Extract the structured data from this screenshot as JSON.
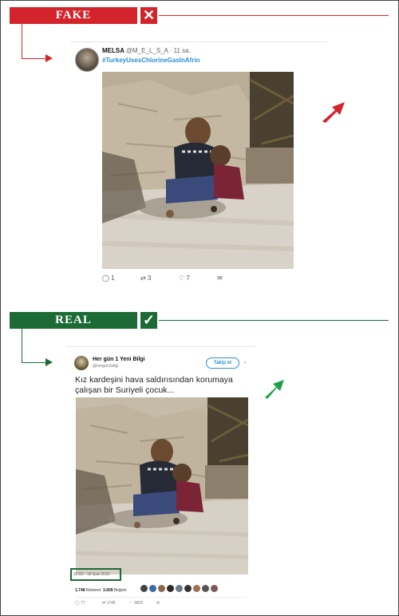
{
  "fake_section": {
    "label": "FAKE",
    "mark": "✕",
    "color": "#d3242b",
    "tweet": {
      "name": "MELSA",
      "handle": "@M_E_L_S_A · 11 sa.",
      "hashtag": "#TurkeyUsesChlorineGasInAfrin",
      "replies": "1",
      "retweets": "3",
      "likes": "7"
    }
  },
  "real_section": {
    "label": "REAL",
    "mark": "✓",
    "color": "#1c6b35",
    "tweet": {
      "name": "Her gün 1 Yeni Bilgi",
      "handle": "@hergun1bilgi",
      "follow_label": "Takip et",
      "text": "Kız kardeşini hava saldırısından korumaya çalışan bir Suriyeli çocuk...",
      "timestamp": "22:50 - 18 Şub 2015",
      "retweets_count": "1.748",
      "retweets_label": "Retweet",
      "likes_count": "3.609",
      "likes_label": "Beğeni",
      "replies": "77",
      "retweets": "1746",
      "likes": "3609"
    }
  },
  "icons": [
    "close-icon",
    "check-icon",
    "reply-icon",
    "retweet-icon",
    "like-icon",
    "message-icon",
    "arrow-pointer-icon"
  ]
}
